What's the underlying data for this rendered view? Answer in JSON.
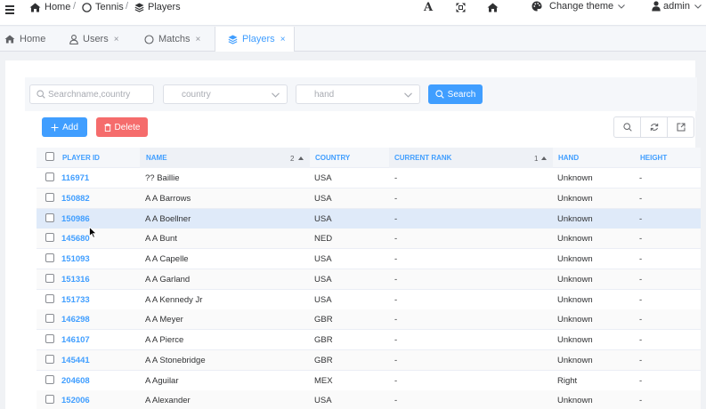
{
  "header": {
    "breadcrumb": [
      {
        "label": "Home",
        "icon": "home-icon"
      },
      {
        "label": "Tennis",
        "icon": "circle-icon"
      },
      {
        "label": "Players",
        "icon": "layers-icon"
      }
    ],
    "separator": "/",
    "font_icon_label": "A",
    "theme_label": "Change theme",
    "user_label": "admin"
  },
  "tabs": [
    {
      "label": "Home",
      "icon": "home-icon",
      "closable": false
    },
    {
      "label": "Users",
      "icon": "user-icon",
      "closable": true
    },
    {
      "label": "Matchs",
      "icon": "circle-icon",
      "closable": true
    },
    {
      "label": "Players",
      "icon": "layers-icon",
      "closable": true,
      "active": true
    }
  ],
  "tab_close": "×",
  "search": {
    "name_placeholder": "Searchname,country",
    "country_placeholder": "country",
    "hand_placeholder": "hand",
    "search_label": "Search"
  },
  "actions": {
    "add_label": "Add",
    "delete_label": "Delete"
  },
  "table": {
    "columns": [
      "PLAYER ID",
      "NAME",
      "COUNTRY",
      "CURRENT RANK",
      "HAND",
      "HEIGHT"
    ],
    "name_sort_order": "2",
    "rank_sort_order": "1",
    "hovered_row": 2,
    "rows": [
      {
        "id": "116971",
        "name": "?? Baillie",
        "country": "USA",
        "rank": "-",
        "hand": "Unknown",
        "height": "-"
      },
      {
        "id": "150882",
        "name": "A A Barrows",
        "country": "USA",
        "rank": "-",
        "hand": "Unknown",
        "height": "-"
      },
      {
        "id": "150986",
        "name": "A A Boellner",
        "country": "USA",
        "rank": "-",
        "hand": "Unknown",
        "height": "-"
      },
      {
        "id": "145680",
        "name": "A A Bunt",
        "country": "NED",
        "rank": "-",
        "hand": "Unknown",
        "height": "-"
      },
      {
        "id": "151093",
        "name": "A A Capelle",
        "country": "USA",
        "rank": "-",
        "hand": "Unknown",
        "height": "-"
      },
      {
        "id": "151316",
        "name": "A A Garland",
        "country": "USA",
        "rank": "-",
        "hand": "Unknown",
        "height": "-"
      },
      {
        "id": "151733",
        "name": "A A Kennedy Jr",
        "country": "USA",
        "rank": "-",
        "hand": "Unknown",
        "height": "-"
      },
      {
        "id": "146298",
        "name": "A A Meyer",
        "country": "GBR",
        "rank": "-",
        "hand": "Unknown",
        "height": "-"
      },
      {
        "id": "146107",
        "name": "A A Pierce",
        "country": "GBR",
        "rank": "-",
        "hand": "Unknown",
        "height": "-"
      },
      {
        "id": "145441",
        "name": "A A Stonebridge",
        "country": "GBR",
        "rank": "-",
        "hand": "Unknown",
        "height": "-"
      },
      {
        "id": "204608",
        "name": "A Aguilar",
        "country": "MEX",
        "rank": "-",
        "hand": "Right",
        "height": "-"
      },
      {
        "id": "152006",
        "name": "A Alexander",
        "country": "USA",
        "rank": "-",
        "hand": "Unknown",
        "height": "-"
      }
    ]
  },
  "colors": {
    "primary": "#409eff",
    "danger": "#f56c6c",
    "row_hover": "#dfeaf9"
  }
}
